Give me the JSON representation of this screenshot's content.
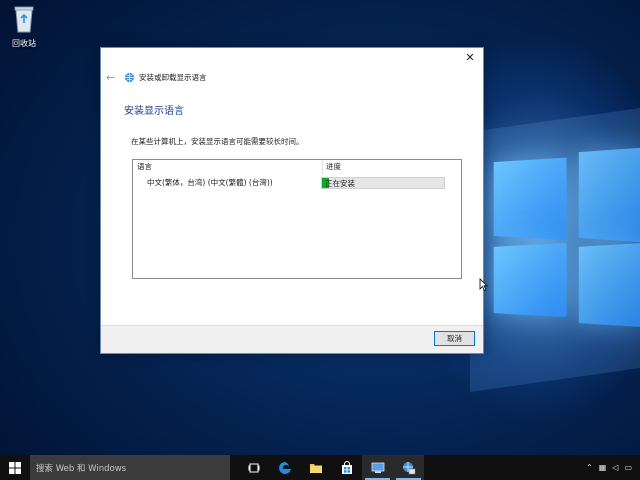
{
  "desktop": {
    "recycle_bin_label": "回收站"
  },
  "dialog": {
    "nav_title": "安装或卸载显示语言",
    "heading": "安装显示语言",
    "note": "在某些计算机上，安装显示语言可能需要较长时间。",
    "columns": {
      "language": "语言",
      "progress": "进度"
    },
    "rows": [
      {
        "language": "中文(繁体，台湾) (中文(繁體) (台灣))",
        "status": "正在安装",
        "progress_fraction": 0.06
      }
    ],
    "cancel_label": "取消"
  },
  "taskbar": {
    "search_placeholder": "搜索 Web 和 Windows"
  },
  "colors": {
    "accent": "#0078d7",
    "progress_green": "#06b025",
    "heading_blue": "#1a3f8f"
  }
}
